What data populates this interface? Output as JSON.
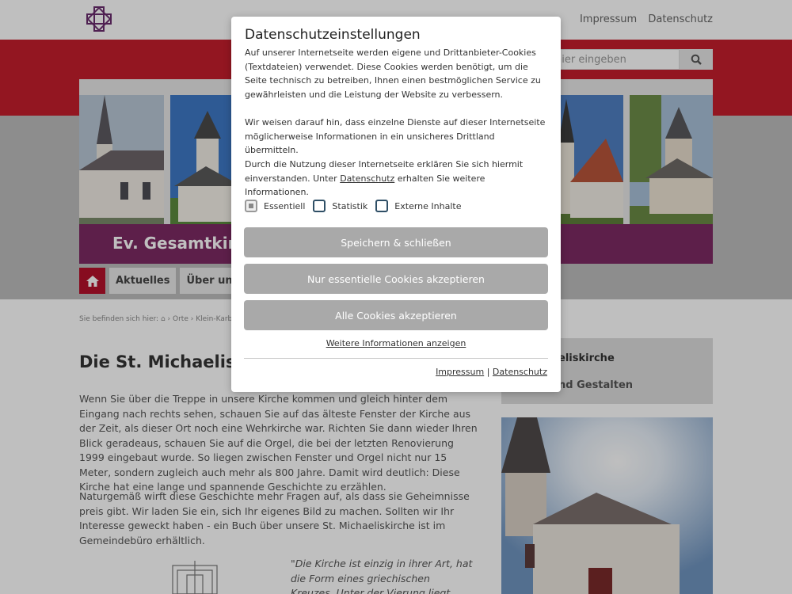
{
  "header": {
    "links": [
      "Impressum",
      "Datenschutz"
    ],
    "search_placeholder": "hier eingeben"
  },
  "banner": {
    "title": "Ev. Gesamtkirc"
  },
  "nav": {
    "items": [
      "Aktuelles",
      "Über uns"
    ]
  },
  "breadcrumb": {
    "prefix": "Sie befinden sich hier:",
    "items": [
      "Orte",
      "Klein-Karben"
    ]
  },
  "main": {
    "title": "Die St. Michaeliski",
    "paragraphs": [
      "Wenn Sie über die Treppe in unsere Kirche kommen und gleich hinter dem Eingang nach rechts sehen, schauen Sie auf das älteste Fenster der Kirche aus der Zeit, als dieser Ort noch eine Wehrkirche war. Richten Sie dann wieder Ihren Blick geradeaus, schauen Sie auf die Orgel, die bei der letzten Renovierung 1999 eingebaut wurde. So liegen zwischen Fenster und Orgel nicht nur 15 Meter, sondern zugleich auch mehr als 800 Jahre. Damit wird deutlich: Diese Kirche hat eine lange und spannende Geschichte zu erzählen.",
      "Naturgemäß wirft diese Geschichte mehr Fragen auf, als dass sie Geheimnisse preis gibt. Wir laden Sie ein, sich Ihr eigenes Bild zu machen. Sollten wir Ihr Interesse geweckt haben - ein Buch über unsere St. Michaeliskirche ist im Gemeindebüro erhältlich."
    ],
    "quote": "\"Die Kirche ist einzig in ihrer Art, hat die Form eines griechischen Kreuzes. Unter der Vierung liegt eine Krypta mit runder"
  },
  "sidebar": {
    "item1": "eliskirche",
    "item2": "nd Gestalten"
  },
  "cookie_modal": {
    "title": "Datenschutzeinstellungen",
    "text1": "Auf unserer Internetseite werden eigene und Drittanbieter-Cookies (Textdateien) verwendet. Diese Cookies werden benötigt, um die Seite technisch zu betreiben, Ihnen einen bestmöglichen Service zu gewährleisten und die Leistung der Website zu verbessern.",
    "text2": "Wir weisen darauf hin, dass einzelne Dienste auf dieser Internetseite möglicherweise Informationen in ein unsicheres Drittland übermitteln.",
    "text3_before": "Durch die Nutzung dieser Internetseite erklären Sie sich hiermit einverstanden. Unter ",
    "text3_link": "Datenschutz",
    "text3_after": " erhalten Sie weitere Informationen.",
    "checkboxes": [
      {
        "label": "Essentiell",
        "checked": true,
        "disabled": true
      },
      {
        "label": "Statistik",
        "checked": false,
        "disabled": false
      },
      {
        "label": "Externe Inhalte",
        "checked": false,
        "disabled": false
      }
    ],
    "btn_save": "Speichern & schließen",
    "btn_essential": "Nur essentielle Cookies akzeptieren",
    "btn_all": "Alle Cookies akzeptieren",
    "more_info": "Weitere Informationen anzeigen",
    "footer_impressum": "Impressum",
    "footer_sep": "|",
    "footer_datenschutz": "Datenschutz"
  },
  "colors": {
    "brand_red": "#c41e2d",
    "banner_purple": "#7d2a63",
    "button_grey": "#a9a9a9"
  }
}
